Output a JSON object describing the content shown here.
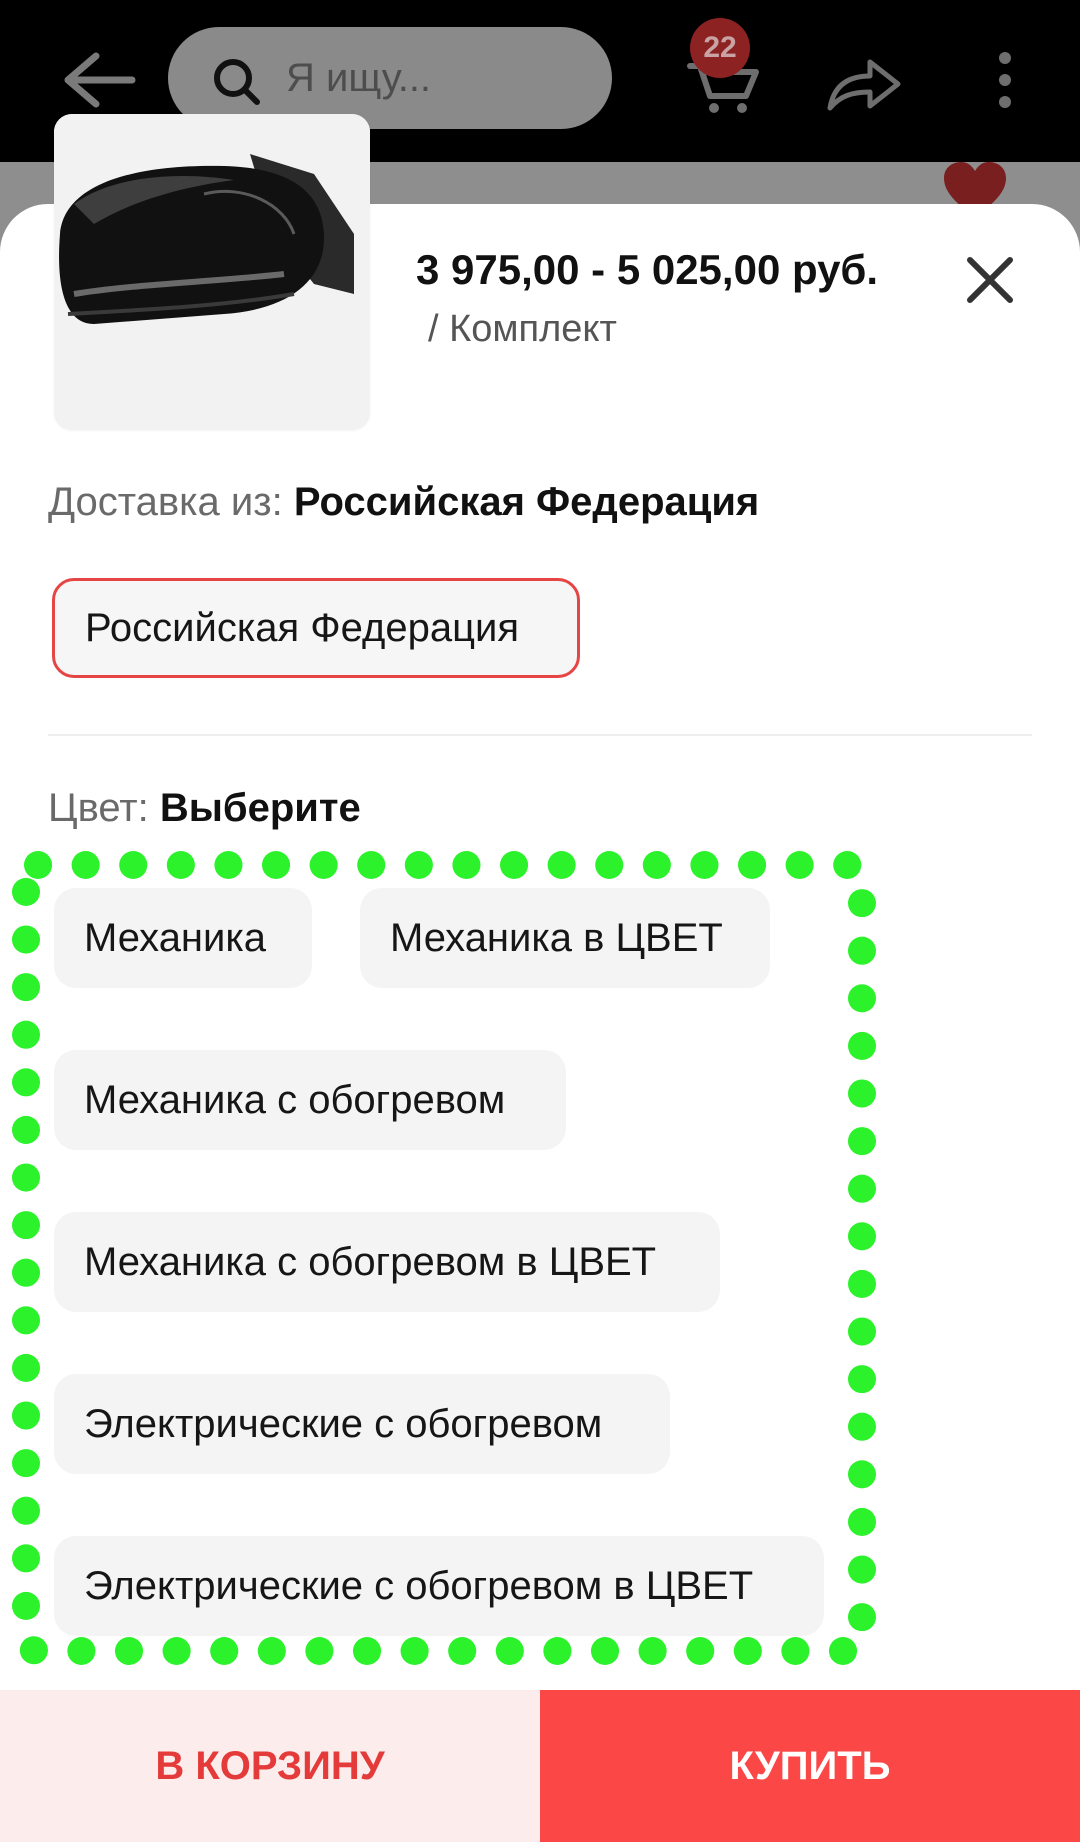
{
  "topbar": {
    "search_placeholder": "Я ищу...",
    "cart_count": "22"
  },
  "sheet": {
    "price": "3 975,00 - 5 025,00 руб.",
    "unit": "/ Комплект",
    "shipping": {
      "label": "Доставка из:",
      "value": "Российская Федерация",
      "options": [
        "Российская Федерация"
      ],
      "selected": "Российская Федерация"
    },
    "color": {
      "label": "Цвет:",
      "value": "Выберите",
      "options": [
        "Механика",
        "Механика в ЦВЕТ",
        "Механика с обогревом",
        "Механика с обогревом в ЦВЕТ",
        "Электрические с обогревом",
        "Электрические с обогревом в ЦВЕТ"
      ]
    }
  },
  "actions": {
    "add_to_cart": "В КОРЗИНУ",
    "buy": "КУПИТЬ"
  },
  "colors": {
    "accent": "#FC4747",
    "accent_text": "#E43A3A",
    "cart_bg": "#FDECEC",
    "highlight_dots": "#2BF22B"
  },
  "icons": [
    "back-arrow-icon",
    "search-icon",
    "cart-icon",
    "share-icon",
    "more-vertical-icon",
    "heart-icon",
    "close-icon"
  ]
}
